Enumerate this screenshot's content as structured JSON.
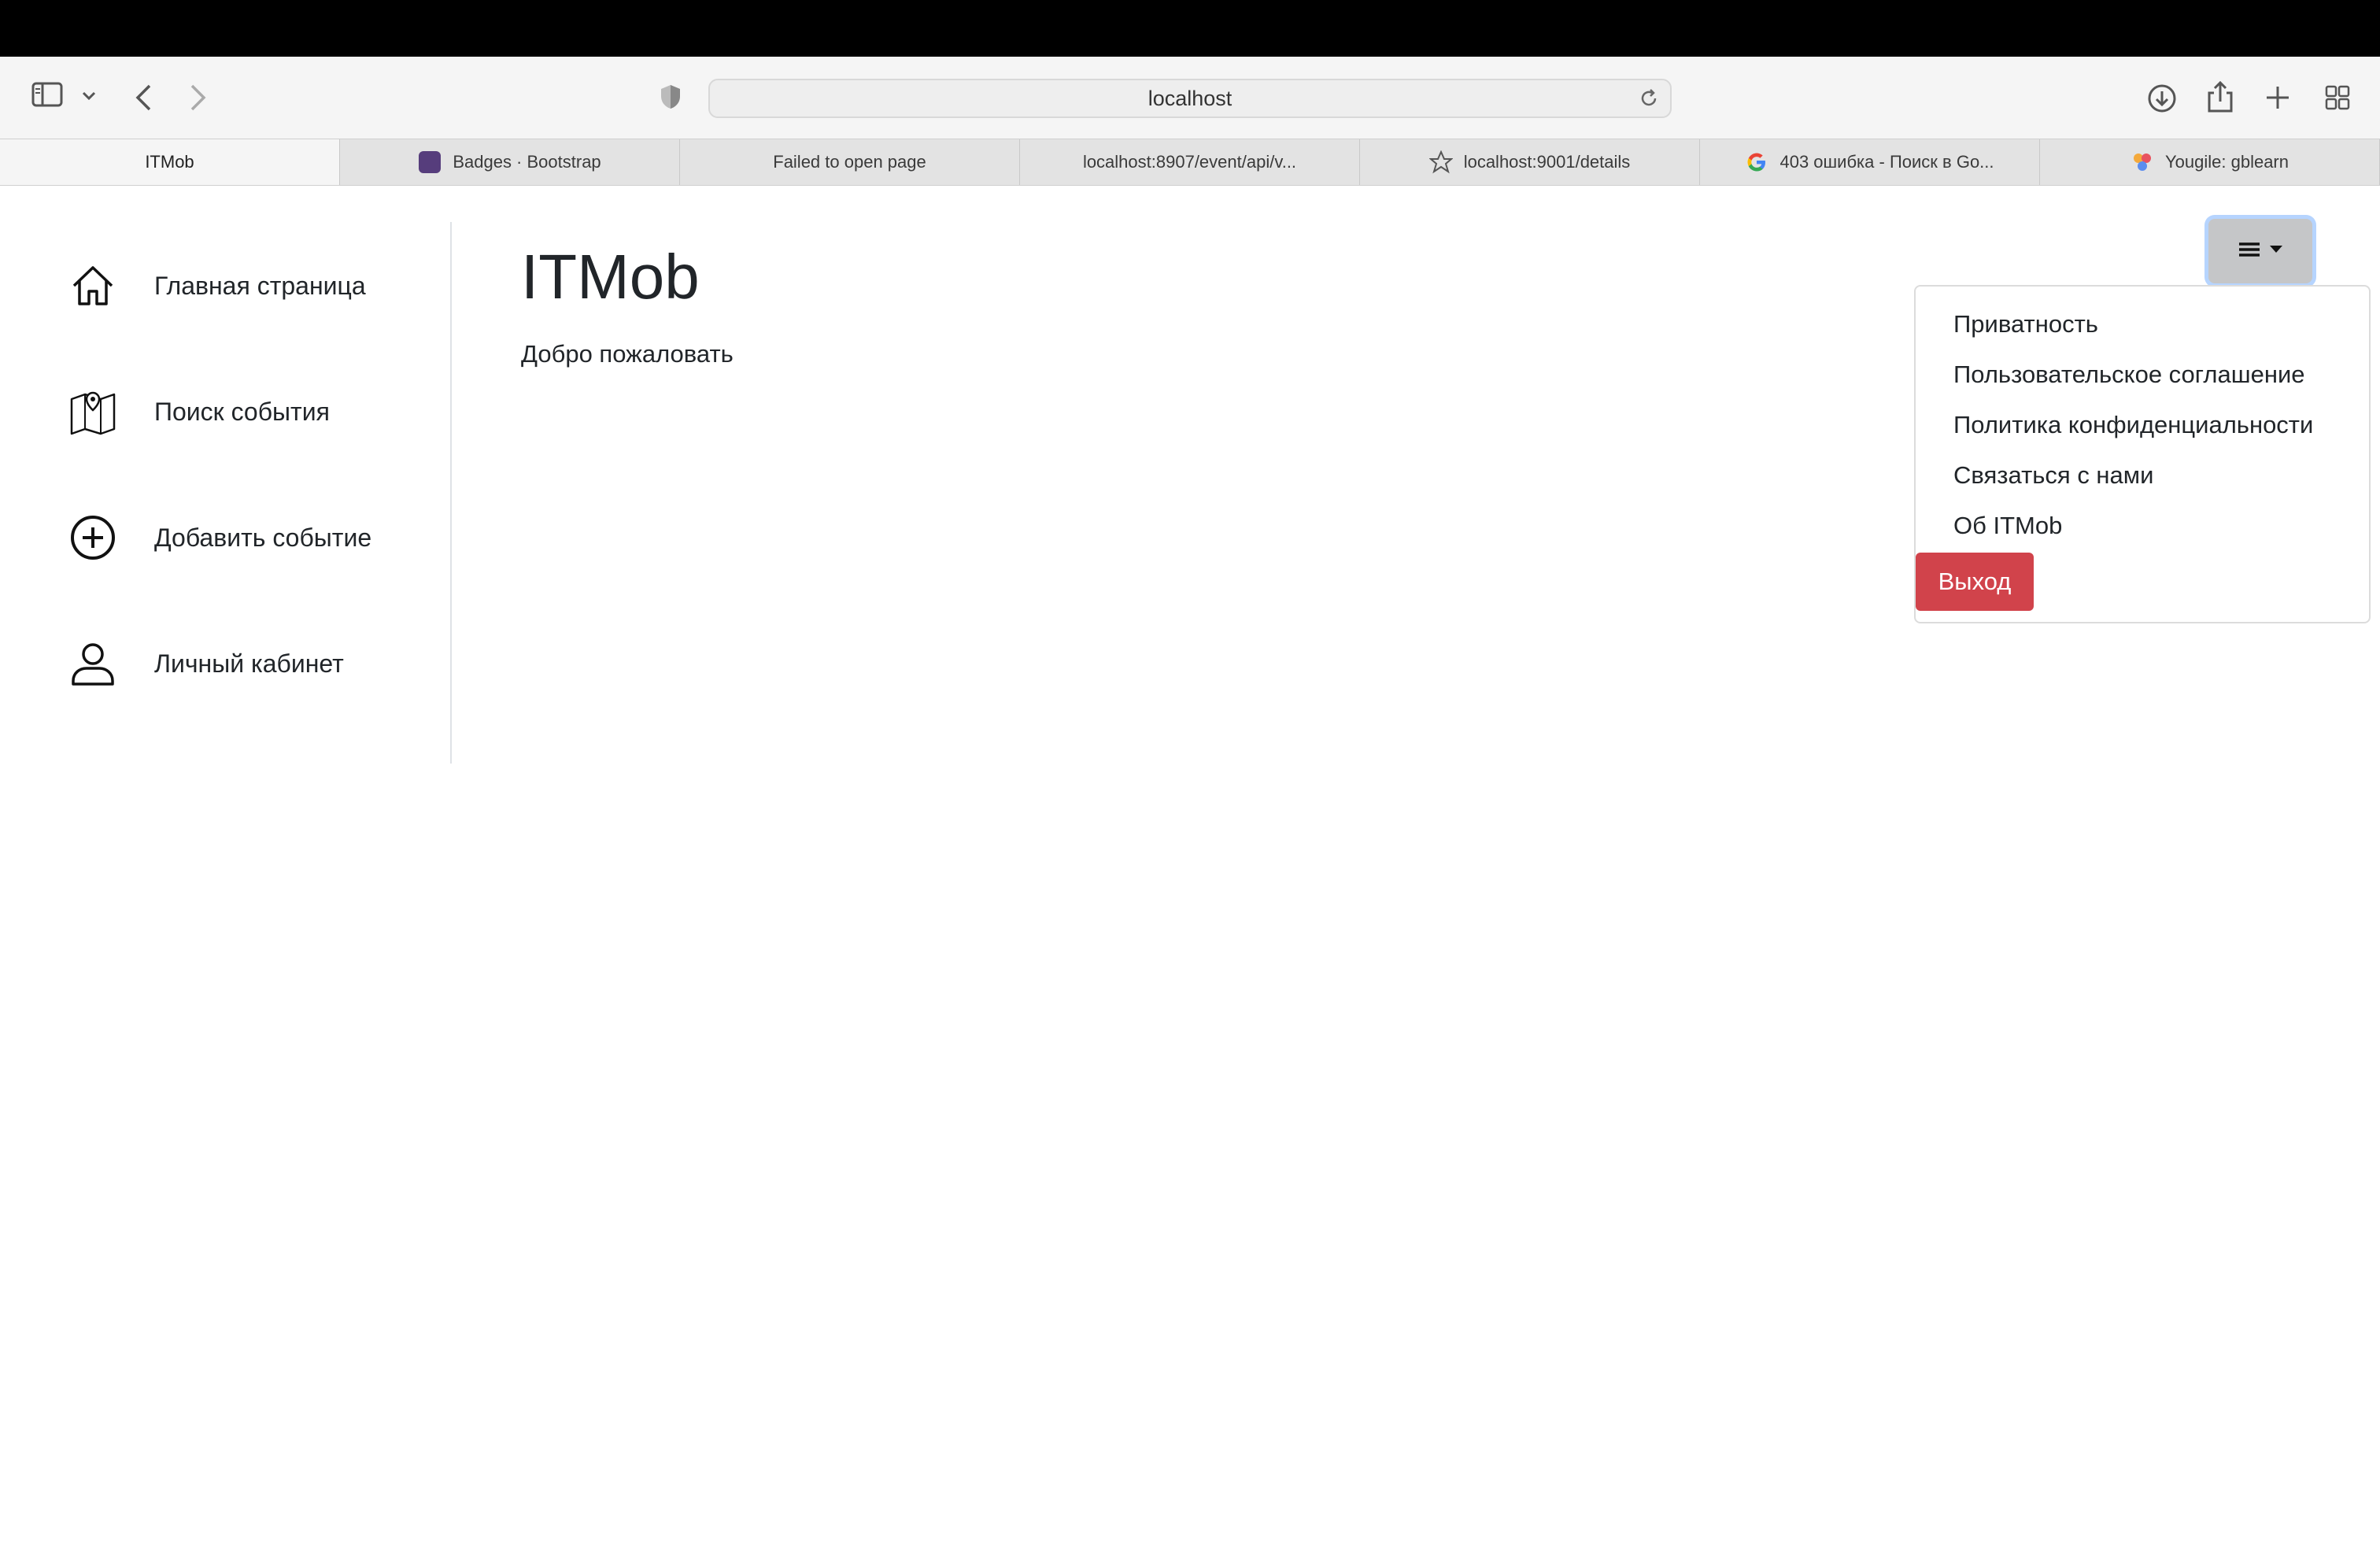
{
  "browser": {
    "address": "localhost",
    "tabs": [
      {
        "label": "ITMob",
        "icon": "none",
        "active": true
      },
      {
        "label": "Badges · Bootstrap",
        "icon": "bootstrap-favicon",
        "active": false
      },
      {
        "label": "Failed to open page",
        "icon": "none",
        "active": false
      },
      {
        "label": "localhost:8907/event/api/v...",
        "icon": "none",
        "active": false
      },
      {
        "label": "localhost:9001/details",
        "icon": "star-icon",
        "active": false
      },
      {
        "label": "403 ошибка - Поиск в Go...",
        "icon": "google-favicon",
        "active": false
      },
      {
        "label": "Yougile: gblearn",
        "icon": "yougile-favicon",
        "active": false
      }
    ]
  },
  "sidebar": {
    "items": [
      {
        "label": "Главная страница",
        "icon": "home-icon"
      },
      {
        "label": "Поиск события",
        "icon": "map-icon"
      },
      {
        "label": "Добавить событие",
        "icon": "plus-circle-icon"
      },
      {
        "label": "Личный кабинет",
        "icon": "person-icon"
      }
    ]
  },
  "main": {
    "title": "ITMob",
    "subtitle": "Добро пожаловать"
  },
  "menu": {
    "toggle_icon": "hamburger-icon",
    "items": [
      "Приватность",
      "Пользовательское соглашение",
      "Политика конфиденциальности",
      "Связаться с нами",
      "Об ITMob"
    ],
    "logout_label": "Выход",
    "logout_color": "#d1434b"
  }
}
